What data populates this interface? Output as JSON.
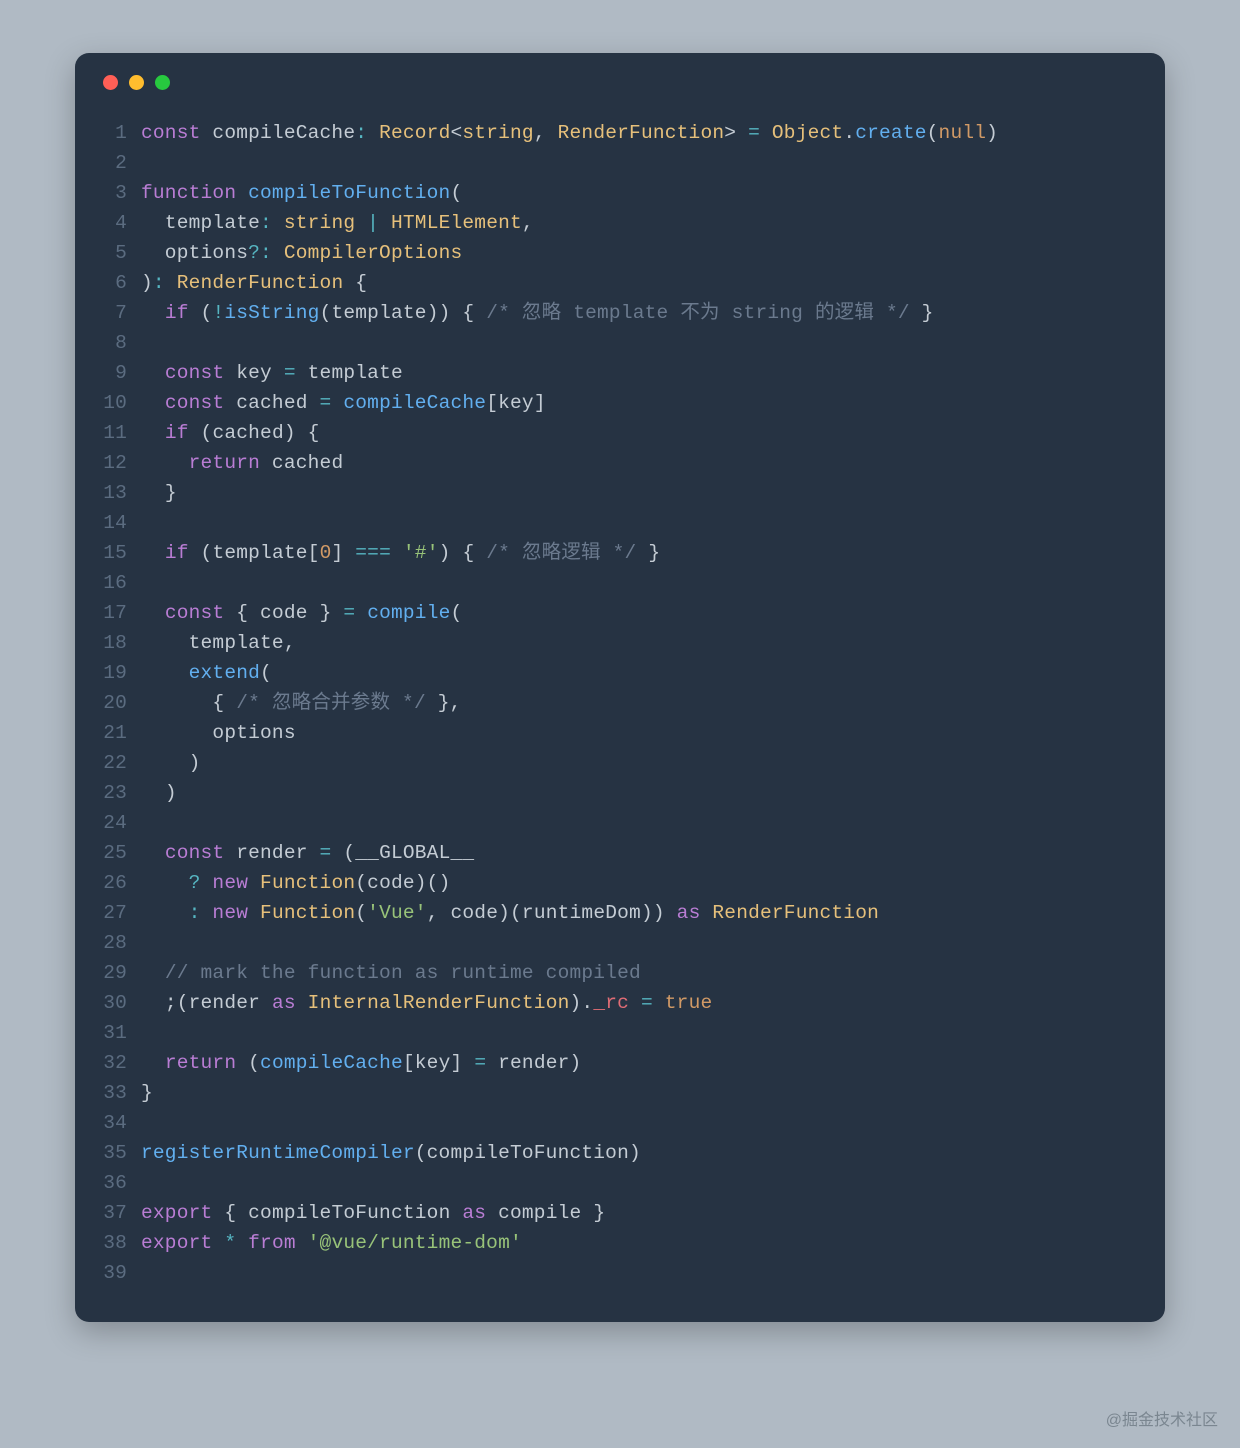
{
  "watermark": "@掘金技术社区",
  "lines": [
    {
      "n": 1,
      "tokens": [
        {
          "c": "tk-kw",
          "t": "const"
        },
        {
          "c": "tk-var",
          "t": " compileCache"
        },
        {
          "c": "tk-op",
          "t": ":"
        },
        {
          "c": "tk-var",
          "t": " "
        },
        {
          "c": "tk-type",
          "t": "Record"
        },
        {
          "c": "tk-punc",
          "t": "<"
        },
        {
          "c": "tk-type",
          "t": "string"
        },
        {
          "c": "tk-punc",
          "t": ", "
        },
        {
          "c": "tk-type",
          "t": "RenderFunction"
        },
        {
          "c": "tk-punc",
          "t": "> "
        },
        {
          "c": "tk-op",
          "t": "="
        },
        {
          "c": "tk-var",
          "t": " "
        },
        {
          "c": "tk-type",
          "t": "Object"
        },
        {
          "c": "tk-punc",
          "t": "."
        },
        {
          "c": "tk-fn",
          "t": "create"
        },
        {
          "c": "tk-punc",
          "t": "("
        },
        {
          "c": "tk-bool",
          "t": "null"
        },
        {
          "c": "tk-punc",
          "t": ")"
        }
      ]
    },
    {
      "n": 2,
      "tokens": []
    },
    {
      "n": 3,
      "tokens": [
        {
          "c": "tk-kw",
          "t": "function"
        },
        {
          "c": "tk-var",
          "t": " "
        },
        {
          "c": "tk-fn",
          "t": "compileToFunction"
        },
        {
          "c": "tk-punc",
          "t": "("
        }
      ]
    },
    {
      "n": 4,
      "tokens": [
        {
          "c": "tk-var",
          "t": "  template"
        },
        {
          "c": "tk-op",
          "t": ":"
        },
        {
          "c": "tk-var",
          "t": " "
        },
        {
          "c": "tk-type",
          "t": "string"
        },
        {
          "c": "tk-var",
          "t": " "
        },
        {
          "c": "tk-op",
          "t": "|"
        },
        {
          "c": "tk-var",
          "t": " "
        },
        {
          "c": "tk-type",
          "t": "HTMLElement"
        },
        {
          "c": "tk-punc",
          "t": ","
        }
      ]
    },
    {
      "n": 5,
      "tokens": [
        {
          "c": "tk-var",
          "t": "  options"
        },
        {
          "c": "tk-op",
          "t": "?:"
        },
        {
          "c": "tk-var",
          "t": " "
        },
        {
          "c": "tk-type",
          "t": "CompilerOptions"
        }
      ]
    },
    {
      "n": 6,
      "tokens": [
        {
          "c": "tk-punc",
          "t": ")"
        },
        {
          "c": "tk-op",
          "t": ":"
        },
        {
          "c": "tk-var",
          "t": " "
        },
        {
          "c": "tk-type",
          "t": "RenderFunction"
        },
        {
          "c": "tk-var",
          "t": " "
        },
        {
          "c": "tk-punc",
          "t": "{"
        }
      ]
    },
    {
      "n": 7,
      "tokens": [
        {
          "c": "tk-var",
          "t": "  "
        },
        {
          "c": "tk-kw",
          "t": "if"
        },
        {
          "c": "tk-var",
          "t": " "
        },
        {
          "c": "tk-punc",
          "t": "("
        },
        {
          "c": "tk-op",
          "t": "!"
        },
        {
          "c": "tk-fn",
          "t": "isString"
        },
        {
          "c": "tk-punc",
          "t": "("
        },
        {
          "c": "tk-var",
          "t": "template"
        },
        {
          "c": "tk-punc",
          "t": "))"
        },
        {
          "c": "tk-var",
          "t": " "
        },
        {
          "c": "tk-punc",
          "t": "{"
        },
        {
          "c": "tk-var",
          "t": " "
        },
        {
          "c": "tk-cmt",
          "t": "/* 忽略 template 不为 string 的逻辑 */"
        },
        {
          "c": "tk-var",
          "t": " "
        },
        {
          "c": "tk-punc",
          "t": "}"
        }
      ]
    },
    {
      "n": 8,
      "tokens": []
    },
    {
      "n": 9,
      "tokens": [
        {
          "c": "tk-var",
          "t": "  "
        },
        {
          "c": "tk-kw",
          "t": "const"
        },
        {
          "c": "tk-var",
          "t": " key "
        },
        {
          "c": "tk-op",
          "t": "="
        },
        {
          "c": "tk-var",
          "t": " template"
        }
      ]
    },
    {
      "n": 10,
      "tokens": [
        {
          "c": "tk-var",
          "t": "  "
        },
        {
          "c": "tk-kw",
          "t": "const"
        },
        {
          "c": "tk-var",
          "t": " cached "
        },
        {
          "c": "tk-op",
          "t": "="
        },
        {
          "c": "tk-var",
          "t": " "
        },
        {
          "c": "tk-fn",
          "t": "compileCache"
        },
        {
          "c": "tk-punc",
          "t": "["
        },
        {
          "c": "tk-var",
          "t": "key"
        },
        {
          "c": "tk-punc",
          "t": "]"
        }
      ]
    },
    {
      "n": 11,
      "tokens": [
        {
          "c": "tk-var",
          "t": "  "
        },
        {
          "c": "tk-kw",
          "t": "if"
        },
        {
          "c": "tk-var",
          "t": " "
        },
        {
          "c": "tk-punc",
          "t": "("
        },
        {
          "c": "tk-var",
          "t": "cached"
        },
        {
          "c": "tk-punc",
          "t": ")"
        },
        {
          "c": "tk-var",
          "t": " "
        },
        {
          "c": "tk-punc",
          "t": "{"
        }
      ]
    },
    {
      "n": 12,
      "tokens": [
        {
          "c": "tk-var",
          "t": "    "
        },
        {
          "c": "tk-kw",
          "t": "return"
        },
        {
          "c": "tk-var",
          "t": " cached"
        }
      ]
    },
    {
      "n": 13,
      "tokens": [
        {
          "c": "tk-var",
          "t": "  "
        },
        {
          "c": "tk-punc",
          "t": "}"
        }
      ]
    },
    {
      "n": 14,
      "tokens": []
    },
    {
      "n": 15,
      "tokens": [
        {
          "c": "tk-var",
          "t": "  "
        },
        {
          "c": "tk-kw",
          "t": "if"
        },
        {
          "c": "tk-var",
          "t": " "
        },
        {
          "c": "tk-punc",
          "t": "("
        },
        {
          "c": "tk-var",
          "t": "template"
        },
        {
          "c": "tk-punc",
          "t": "["
        },
        {
          "c": "tk-num",
          "t": "0"
        },
        {
          "c": "tk-punc",
          "t": "]"
        },
        {
          "c": "tk-var",
          "t": " "
        },
        {
          "c": "tk-op",
          "t": "==="
        },
        {
          "c": "tk-var",
          "t": " "
        },
        {
          "c": "tk-str",
          "t": "'#'"
        },
        {
          "c": "tk-punc",
          "t": ")"
        },
        {
          "c": "tk-var",
          "t": " "
        },
        {
          "c": "tk-punc",
          "t": "{"
        },
        {
          "c": "tk-var",
          "t": " "
        },
        {
          "c": "tk-cmt",
          "t": "/* 忽略逻辑 */"
        },
        {
          "c": "tk-var",
          "t": " "
        },
        {
          "c": "tk-punc",
          "t": "}"
        }
      ]
    },
    {
      "n": 16,
      "tokens": []
    },
    {
      "n": 17,
      "tokens": [
        {
          "c": "tk-var",
          "t": "  "
        },
        {
          "c": "tk-kw",
          "t": "const"
        },
        {
          "c": "tk-var",
          "t": " "
        },
        {
          "c": "tk-punc",
          "t": "{"
        },
        {
          "c": "tk-var",
          "t": " code "
        },
        {
          "c": "tk-punc",
          "t": "}"
        },
        {
          "c": "tk-var",
          "t": " "
        },
        {
          "c": "tk-op",
          "t": "="
        },
        {
          "c": "tk-var",
          "t": " "
        },
        {
          "c": "tk-fn",
          "t": "compile"
        },
        {
          "c": "tk-punc",
          "t": "("
        }
      ]
    },
    {
      "n": 18,
      "tokens": [
        {
          "c": "tk-var",
          "t": "    template"
        },
        {
          "c": "tk-punc",
          "t": ","
        }
      ]
    },
    {
      "n": 19,
      "tokens": [
        {
          "c": "tk-var",
          "t": "    "
        },
        {
          "c": "tk-fn",
          "t": "extend"
        },
        {
          "c": "tk-punc",
          "t": "("
        }
      ]
    },
    {
      "n": 20,
      "tokens": [
        {
          "c": "tk-var",
          "t": "      "
        },
        {
          "c": "tk-punc",
          "t": "{"
        },
        {
          "c": "tk-var",
          "t": " "
        },
        {
          "c": "tk-cmt",
          "t": "/* 忽略合并参数 */"
        },
        {
          "c": "tk-var",
          "t": " "
        },
        {
          "c": "tk-punc",
          "t": "},"
        }
      ]
    },
    {
      "n": 21,
      "tokens": [
        {
          "c": "tk-var",
          "t": "      options"
        }
      ]
    },
    {
      "n": 22,
      "tokens": [
        {
          "c": "tk-var",
          "t": "    "
        },
        {
          "c": "tk-punc",
          "t": ")"
        }
      ]
    },
    {
      "n": 23,
      "tokens": [
        {
          "c": "tk-var",
          "t": "  "
        },
        {
          "c": "tk-punc",
          "t": ")"
        }
      ]
    },
    {
      "n": 24,
      "tokens": []
    },
    {
      "n": 25,
      "tokens": [
        {
          "c": "tk-var",
          "t": "  "
        },
        {
          "c": "tk-kw",
          "t": "const"
        },
        {
          "c": "tk-var",
          "t": " render "
        },
        {
          "c": "tk-op",
          "t": "="
        },
        {
          "c": "tk-var",
          "t": " "
        },
        {
          "c": "tk-punc",
          "t": "("
        },
        {
          "c": "tk-var",
          "t": "__GLOBAL__"
        }
      ]
    },
    {
      "n": 26,
      "tokens": [
        {
          "c": "tk-var",
          "t": "    "
        },
        {
          "c": "tk-op",
          "t": "?"
        },
        {
          "c": "tk-var",
          "t": " "
        },
        {
          "c": "tk-kw",
          "t": "new"
        },
        {
          "c": "tk-var",
          "t": " "
        },
        {
          "c": "tk-type",
          "t": "Function"
        },
        {
          "c": "tk-punc",
          "t": "("
        },
        {
          "c": "tk-var",
          "t": "code"
        },
        {
          "c": "tk-punc",
          "t": ")()"
        }
      ]
    },
    {
      "n": 27,
      "tokens": [
        {
          "c": "tk-var",
          "t": "    "
        },
        {
          "c": "tk-op",
          "t": ":"
        },
        {
          "c": "tk-var",
          "t": " "
        },
        {
          "c": "tk-kw",
          "t": "new"
        },
        {
          "c": "tk-var",
          "t": " "
        },
        {
          "c": "tk-type",
          "t": "Function"
        },
        {
          "c": "tk-punc",
          "t": "("
        },
        {
          "c": "tk-str",
          "t": "'Vue'"
        },
        {
          "c": "tk-punc",
          "t": ", "
        },
        {
          "c": "tk-var",
          "t": "code"
        },
        {
          "c": "tk-punc",
          "t": ")("
        },
        {
          "c": "tk-var",
          "t": "runtimeDom"
        },
        {
          "c": "tk-punc",
          "t": "))"
        },
        {
          "c": "tk-var",
          "t": " "
        },
        {
          "c": "tk-kw",
          "t": "as"
        },
        {
          "c": "tk-var",
          "t": " "
        },
        {
          "c": "tk-type",
          "t": "RenderFunction"
        }
      ]
    },
    {
      "n": 28,
      "tokens": []
    },
    {
      "n": 29,
      "tokens": [
        {
          "c": "tk-var",
          "t": "  "
        },
        {
          "c": "tk-cmt",
          "t": "// mark the function as runtime compiled"
        }
      ]
    },
    {
      "n": 30,
      "tokens": [
        {
          "c": "tk-var",
          "t": "  "
        },
        {
          "c": "tk-punc",
          "t": ";("
        },
        {
          "c": "tk-var",
          "t": "render "
        },
        {
          "c": "tk-kw",
          "t": "as"
        },
        {
          "c": "tk-var",
          "t": " "
        },
        {
          "c": "tk-type",
          "t": "InternalRenderFunction"
        },
        {
          "c": "tk-punc",
          "t": ")."
        },
        {
          "c": "tk-prop",
          "t": "_rc"
        },
        {
          "c": "tk-var",
          "t": " "
        },
        {
          "c": "tk-op",
          "t": "="
        },
        {
          "c": "tk-var",
          "t": " "
        },
        {
          "c": "tk-bool",
          "t": "true"
        }
      ]
    },
    {
      "n": 31,
      "tokens": []
    },
    {
      "n": 32,
      "tokens": [
        {
          "c": "tk-var",
          "t": "  "
        },
        {
          "c": "tk-kw",
          "t": "return"
        },
        {
          "c": "tk-var",
          "t": " "
        },
        {
          "c": "tk-punc",
          "t": "("
        },
        {
          "c": "tk-fn",
          "t": "compileCache"
        },
        {
          "c": "tk-punc",
          "t": "["
        },
        {
          "c": "tk-var",
          "t": "key"
        },
        {
          "c": "tk-punc",
          "t": "]"
        },
        {
          "c": "tk-var",
          "t": " "
        },
        {
          "c": "tk-op",
          "t": "="
        },
        {
          "c": "tk-var",
          "t": " render"
        },
        {
          "c": "tk-punc",
          "t": ")"
        }
      ]
    },
    {
      "n": 33,
      "tokens": [
        {
          "c": "tk-punc",
          "t": "}"
        }
      ]
    },
    {
      "n": 34,
      "tokens": []
    },
    {
      "n": 35,
      "tokens": [
        {
          "c": "tk-fn",
          "t": "registerRuntimeCompiler"
        },
        {
          "c": "tk-punc",
          "t": "("
        },
        {
          "c": "tk-var",
          "t": "compileToFunction"
        },
        {
          "c": "tk-punc",
          "t": ")"
        }
      ]
    },
    {
      "n": 36,
      "tokens": []
    },
    {
      "n": 37,
      "tokens": [
        {
          "c": "tk-kw",
          "t": "export"
        },
        {
          "c": "tk-var",
          "t": " "
        },
        {
          "c": "tk-punc",
          "t": "{"
        },
        {
          "c": "tk-var",
          "t": " compileToFunction "
        },
        {
          "c": "tk-kw",
          "t": "as"
        },
        {
          "c": "tk-var",
          "t": " compile "
        },
        {
          "c": "tk-punc",
          "t": "}"
        }
      ]
    },
    {
      "n": 38,
      "tokens": [
        {
          "c": "tk-kw",
          "t": "export"
        },
        {
          "c": "tk-var",
          "t": " "
        },
        {
          "c": "tk-op",
          "t": "*"
        },
        {
          "c": "tk-var",
          "t": " "
        },
        {
          "c": "tk-kw",
          "t": "from"
        },
        {
          "c": "tk-var",
          "t": " "
        },
        {
          "c": "tk-str",
          "t": "'@vue/runtime-dom'"
        }
      ]
    },
    {
      "n": 39,
      "tokens": []
    }
  ]
}
